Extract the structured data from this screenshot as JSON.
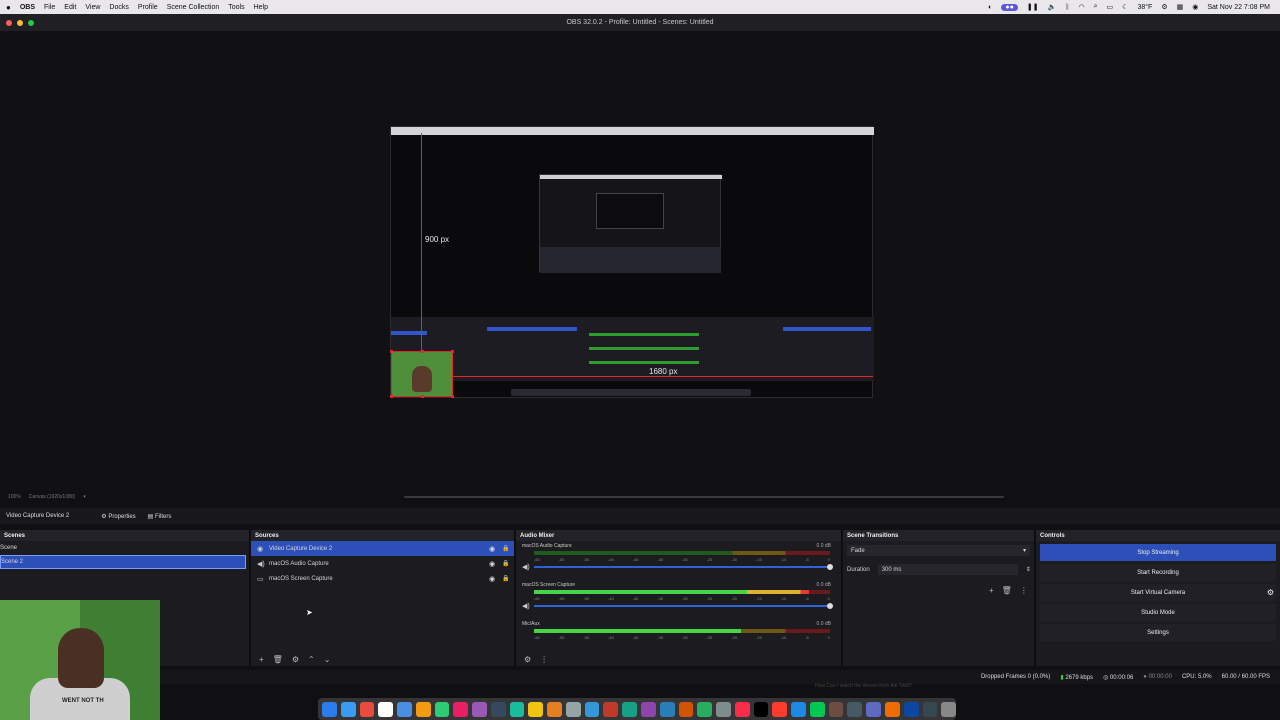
{
  "menubar": {
    "app": "OBS",
    "items": [
      "File",
      "Edit",
      "View",
      "Docks",
      "Profile",
      "Scene Collection",
      "Tools",
      "Help"
    ],
    "temperature": "38°F",
    "clock": "Sat Nov 22  7:08 PM"
  },
  "window": {
    "title": "OBS 32.0.2 - Profile: Untitled - Scenes: Untitled"
  },
  "preview": {
    "height_label": "900 px",
    "width_label": "1680 px"
  },
  "canvas": {
    "zoom": "100%",
    "canvas_label": "Canvas (1920x1080)"
  },
  "source_toolbar": {
    "selected_source": "Video Capture Device 2",
    "properties_label": "Properties",
    "filters_label": "Filters"
  },
  "scenes": {
    "title": "Scenes",
    "items": [
      {
        "label": "Scene",
        "selected": false
      },
      {
        "label": "Scene 2",
        "selected": true
      }
    ]
  },
  "sources": {
    "title": "Sources",
    "items": [
      {
        "label": "Video Capture Device 2",
        "icon": "camera-icon",
        "selected": true
      },
      {
        "label": "macOS Audio Capture",
        "icon": "speaker-icon",
        "selected": false
      },
      {
        "label": "macOS Screen Capture",
        "icon": "monitor-icon",
        "selected": false
      }
    ]
  },
  "mixer": {
    "title": "Audio Mixer",
    "channels": [
      {
        "name": "macOS Audio Capture",
        "db": "0.0 dB",
        "level": 0.0
      },
      {
        "name": "macOS Screen Capture",
        "db": "0.0 dB",
        "level": 0.93
      },
      {
        "name": "Mic/Aux",
        "db": "0.0 dB",
        "level": 0.7
      }
    ],
    "ticks": [
      "-60",
      "-55",
      "-50",
      "-45",
      "-40",
      "-35",
      "-30",
      "-25",
      "-20",
      "-15",
      "-10",
      "-5",
      "0"
    ]
  },
  "transitions": {
    "title": "Scene Transitions",
    "selected": "Fade",
    "duration_label": "Duration",
    "duration_value": "300 ms"
  },
  "controls": {
    "title": "Controls",
    "stop_streaming": "Stop Streaming",
    "start_recording": "Start Recording",
    "start_virtual_camera": "Start Virtual Camera",
    "studio_mode": "Studio Mode",
    "settings": "Settings"
  },
  "status": {
    "dropped_frames": "Dropped Frames 0 (0.0%)",
    "bitrate": "2679 kbps",
    "stream_time": "00:00:06",
    "record_time": "00:00:00",
    "cpu": "CPU: 5.0%",
    "fps": "60.00 / 60.00 FPS"
  },
  "webcam": {
    "shirt_text": "WENT NOT TH"
  },
  "caption": {
    "text": "How Can I watch the stream from the Twitt?"
  },
  "colors": {
    "accent": "#2d4fb8",
    "guide_red": "#e02a2a"
  }
}
